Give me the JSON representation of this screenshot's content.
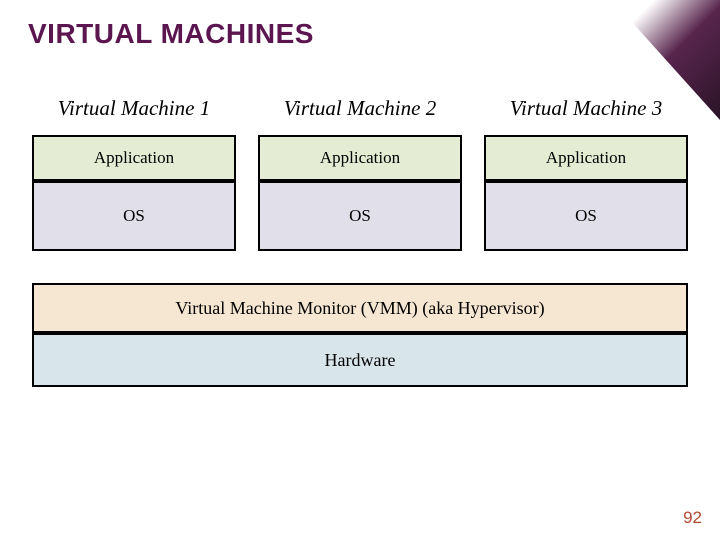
{
  "title": "VIRTUAL MACHINES",
  "columns": [
    {
      "label": "Virtual Machine 1",
      "app": "Application",
      "os": "OS"
    },
    {
      "label": "Virtual Machine 2",
      "app": "Application",
      "os": "OS"
    },
    {
      "label": "Virtual Machine 3",
      "app": "Application",
      "os": "OS"
    }
  ],
  "vmm": "Virtual Machine Monitor (VMM) (aka Hypervisor)",
  "hardware": "Hardware",
  "page_number": "92"
}
